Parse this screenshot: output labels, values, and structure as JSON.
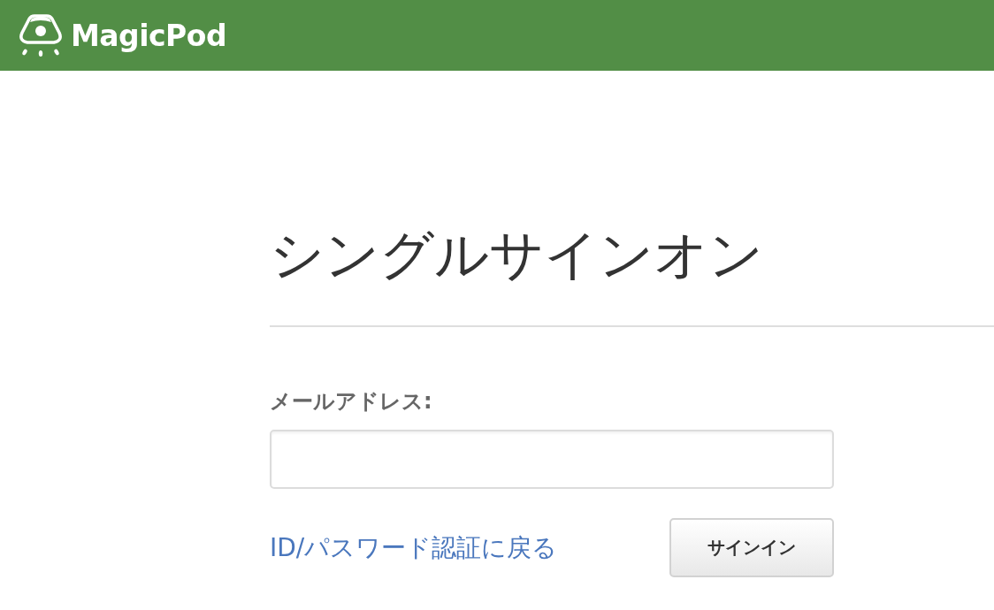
{
  "header": {
    "logo_text": "MagicPod"
  },
  "title": "シングルサインオン",
  "form": {
    "email_label": "メールアドレス:",
    "back_link": "ID/パスワード認証に戻る",
    "submit_button": "サインイン"
  }
}
